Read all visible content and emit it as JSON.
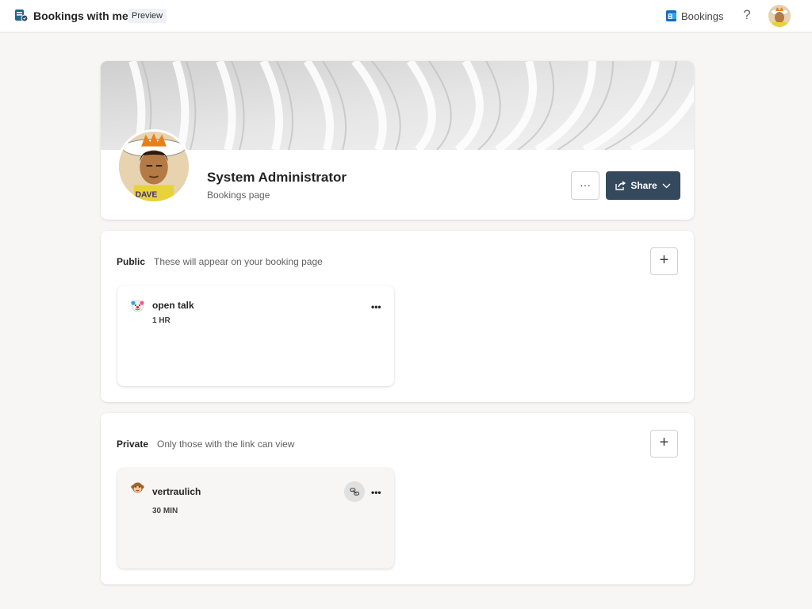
{
  "topbar": {
    "app_title": "Bookings with me",
    "badge": "Preview",
    "bookings_link": "Bookings",
    "help_glyph": "?"
  },
  "profile": {
    "name": "System Administrator",
    "subtitle": "Bookings page",
    "more_glyph": "···",
    "share_label": "Share"
  },
  "sections": {
    "public": {
      "label": "Public",
      "description": "These will appear on your booking page",
      "add_glyph": "+",
      "services": [
        {
          "name": "open talk",
          "duration": "1 HR",
          "emoji": "clown-face-icon"
        }
      ]
    },
    "private": {
      "label": "Private",
      "description": "Only those with the link can view",
      "add_glyph": "+",
      "services": [
        {
          "name": "vertraulich",
          "duration": "30 MIN",
          "emoji": "monkey-face-icon"
        }
      ]
    }
  },
  "colors": {
    "share_button": "#35495e",
    "background": "#f7f6f4",
    "bookings_brand": "#0f6cbd"
  }
}
